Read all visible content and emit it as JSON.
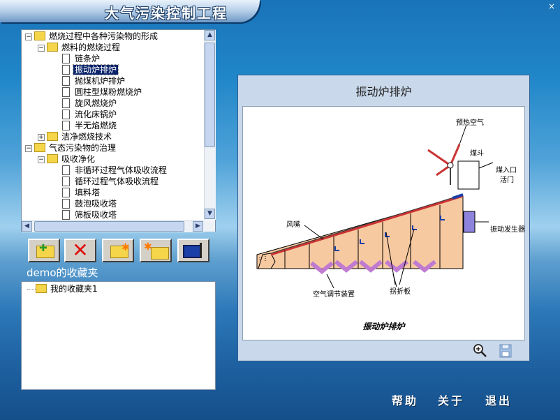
{
  "app": {
    "title": "大气污染控制工程",
    "close_symbol": "×"
  },
  "tree": {
    "items": [
      {
        "label": "燃烧过程中各种污染物的形成",
        "level": 0,
        "type": "folder",
        "expander": "−"
      },
      {
        "label": "燃料的燃烧过程",
        "level": 1,
        "type": "folder",
        "expander": "−"
      },
      {
        "label": "链条炉",
        "level": 2,
        "type": "doc"
      },
      {
        "label": "振动炉排炉",
        "level": 2,
        "type": "doc",
        "selected": true
      },
      {
        "label": "抛煤机炉排炉",
        "level": 2,
        "type": "doc"
      },
      {
        "label": "圆柱型煤粉燃烧炉",
        "level": 2,
        "type": "doc"
      },
      {
        "label": "旋风燃烧炉",
        "level": 2,
        "type": "doc"
      },
      {
        "label": "流化床锅炉",
        "level": 2,
        "type": "doc"
      },
      {
        "label": "半无焰燃烧",
        "level": 2,
        "type": "doc"
      },
      {
        "label": "洁净燃烧技术",
        "level": 1,
        "type": "folder",
        "expander": "+"
      },
      {
        "label": "气态污染物的治理",
        "level": 0,
        "type": "folder",
        "expander": "−"
      },
      {
        "label": "吸收净化",
        "level": 1,
        "type": "folder",
        "expander": "−"
      },
      {
        "label": "非循环过程气体吸收流程",
        "level": 2,
        "type": "doc"
      },
      {
        "label": "循环过程气体吸收流程",
        "level": 2,
        "type": "doc"
      },
      {
        "label": "填料塔",
        "level": 2,
        "type": "doc"
      },
      {
        "label": "鼓泡吸收塔",
        "level": 2,
        "type": "doc"
      },
      {
        "label": "筛板吸收塔",
        "level": 2,
        "type": "doc"
      }
    ]
  },
  "favorites": {
    "title": "demo的收藏夹",
    "items": [
      {
        "label": "我的收藏夹1"
      }
    ]
  },
  "viewer": {
    "title": "振动炉排炉",
    "caption": "振动炉排炉",
    "labels": {
      "preheat_air": "预热空气",
      "coal_hopper": "煤斗",
      "coal_inlet": "煤入口",
      "movable_door": "活门",
      "tuyere": "风嘴",
      "vibration_generator": "振动发生器",
      "air_regulator": "空气调节装置",
      "baffle": "拐折板"
    }
  },
  "nav": {
    "help": "帮助",
    "about": "关于",
    "exit": "退出"
  },
  "colors": {
    "furnace_fill": "#f7c9a0",
    "selection": "#0a246a",
    "accent_blue": "#1d5f9f"
  }
}
